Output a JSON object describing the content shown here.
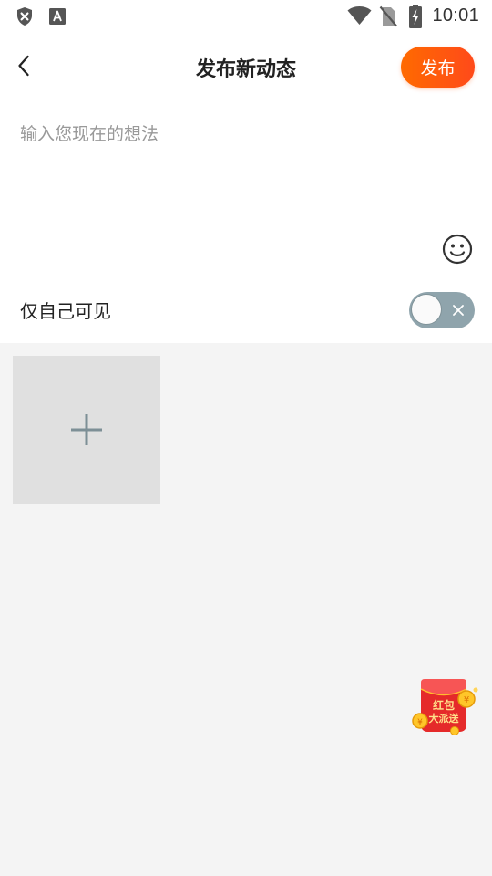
{
  "status_bar": {
    "time": "10:01",
    "left_icons": [
      "shield-x-icon",
      "text-a-icon"
    ],
    "right_icons": [
      "wifi-icon",
      "no-sim-icon",
      "battery-charging-icon"
    ]
  },
  "header": {
    "title": "发布新动态",
    "back_icon": "chevron-left-icon",
    "publish_label": "发布"
  },
  "compose": {
    "placeholder": "输入您现在的想法",
    "value": "",
    "emoji_icon": "smiley-icon"
  },
  "privacy": {
    "label": "仅自己可见",
    "toggle_on": false
  },
  "media": {
    "add_icon": "plus-icon"
  },
  "promo": {
    "text_line1": "红包",
    "text_line2": "大派送"
  },
  "colors": {
    "accent_start": "#ff6a00",
    "accent_end": "#ff4a1a",
    "toggle_off": "#8fa4ac",
    "background": "#f4f4f4",
    "add_tile": "#e0e0e0"
  }
}
